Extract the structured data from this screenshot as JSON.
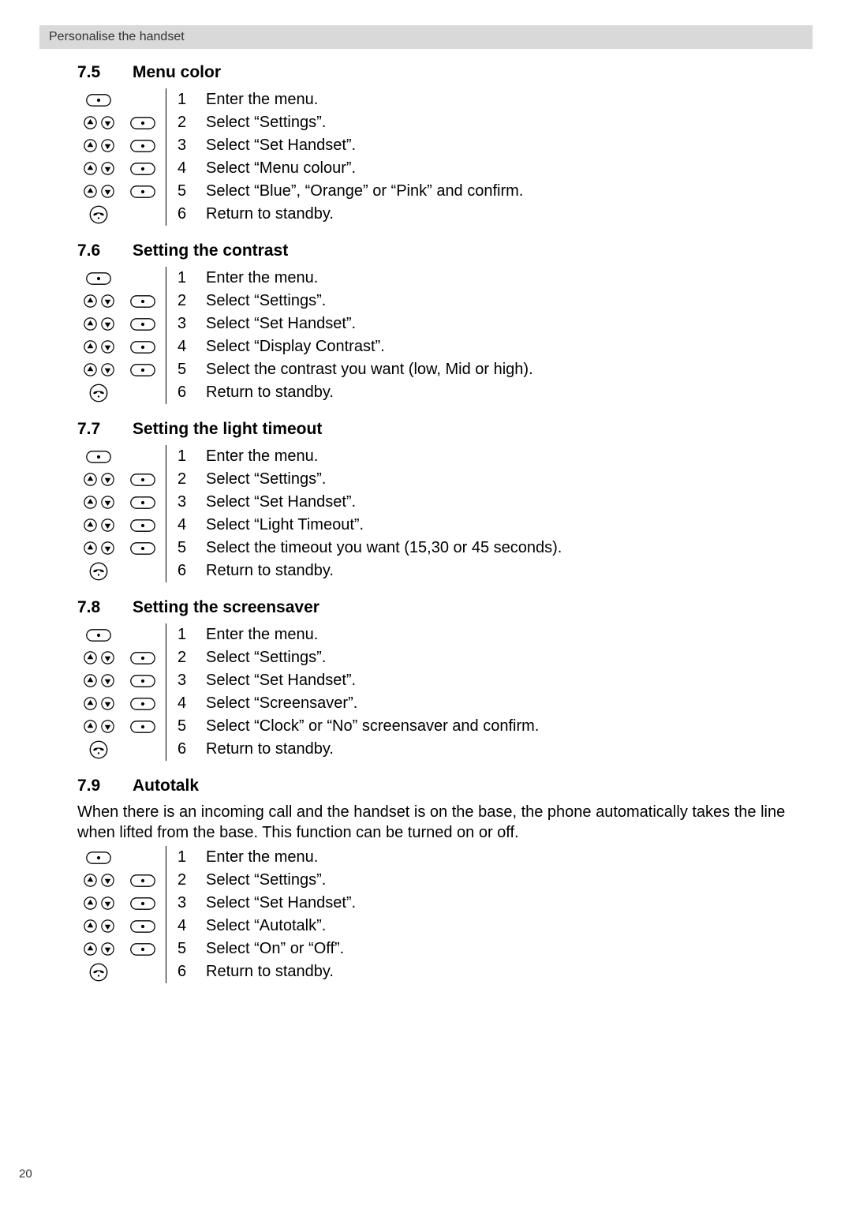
{
  "header": {
    "title": "Personalise the handset"
  },
  "page_number": "20",
  "icons": {
    "menu": {
      "name": "menu-icon"
    },
    "up": {
      "name": "up-icon"
    },
    "down": {
      "name": "down-icon"
    },
    "hangup": {
      "name": "hangup-icon"
    }
  },
  "sections": [
    {
      "number": "7.5",
      "title": "Menu color",
      "intro": "",
      "steps": [
        {
          "icons": [
            "menu"
          ],
          "num": "1",
          "text": "Enter the menu."
        },
        {
          "icons": [
            "updown",
            "menu"
          ],
          "num": "2",
          "text": "Select “Settings”."
        },
        {
          "icons": [
            "updown",
            "menu"
          ],
          "num": "3",
          "text": "Select “Set Handset”."
        },
        {
          "icons": [
            "updown",
            "menu"
          ],
          "num": "4",
          "text": "Select “Menu colour”."
        },
        {
          "icons": [
            "updown",
            "menu"
          ],
          "num": "5",
          "text": "Select “Blue”, “Orange” or “Pink” and confirm."
        },
        {
          "icons": [
            "hangup"
          ],
          "num": "6",
          "text": "Return to standby."
        }
      ]
    },
    {
      "number": "7.6",
      "title": "Setting the contrast",
      "intro": "",
      "steps": [
        {
          "icons": [
            "menu"
          ],
          "num": "1",
          "text": "Enter the menu."
        },
        {
          "icons": [
            "updown",
            "menu"
          ],
          "num": "2",
          "text": "Select “Settings”."
        },
        {
          "icons": [
            "updown",
            "menu"
          ],
          "num": "3",
          "text": "Select “Set Handset”."
        },
        {
          "icons": [
            "updown",
            "menu"
          ],
          "num": "4",
          "text": "Select “Display Contrast”."
        },
        {
          "icons": [
            "updown",
            "menu"
          ],
          "num": "5",
          "text": "Select the contrast you want (low, Mid or high)."
        },
        {
          "icons": [
            "hangup"
          ],
          "num": "6",
          "text": "Return to standby."
        }
      ]
    },
    {
      "number": "7.7",
      "title": "Setting the light timeout",
      "intro": "",
      "steps": [
        {
          "icons": [
            "menu"
          ],
          "num": "1",
          "text": "Enter the menu."
        },
        {
          "icons": [
            "updown",
            "menu"
          ],
          "num": "2",
          "text": "Select “Settings”."
        },
        {
          "icons": [
            "updown",
            "menu"
          ],
          "num": "3",
          "text": "Select “Set Handset”."
        },
        {
          "icons": [
            "updown",
            "menu"
          ],
          "num": "4",
          "text": "Select “Light Timeout”."
        },
        {
          "icons": [
            "updown",
            "menu"
          ],
          "num": "5",
          "text": "Select the timeout you want (15,30 or 45 seconds)."
        },
        {
          "icons": [
            "hangup"
          ],
          "num": "6",
          "text": "Return to standby."
        }
      ]
    },
    {
      "number": "7.8",
      "title": "Setting the screensaver",
      "intro": "",
      "steps": [
        {
          "icons": [
            "menu"
          ],
          "num": "1",
          "text": "Enter the menu."
        },
        {
          "icons": [
            "updown",
            "menu"
          ],
          "num": "2",
          "text": "Select “Settings”."
        },
        {
          "icons": [
            "updown",
            "menu"
          ],
          "num": "3",
          "text": "Select “Set Handset”."
        },
        {
          "icons": [
            "updown",
            "menu"
          ],
          "num": "4",
          "text": "Select “Screensaver”."
        },
        {
          "icons": [
            "updown",
            "menu"
          ],
          "num": "5",
          "text": "Select “Clock” or “No” screensaver and confirm."
        },
        {
          "icons": [
            "hangup"
          ],
          "num": "6",
          "text": "Return to standby."
        }
      ]
    },
    {
      "number": "7.9",
      "title": "Autotalk",
      "intro": "When there is an incoming call and the handset is on the base, the phone automatically takes the line when lifted from the base. This function can be turned on or off.",
      "steps": [
        {
          "icons": [
            "menu"
          ],
          "num": "1",
          "text": "Enter the menu."
        },
        {
          "icons": [
            "updown",
            "menu"
          ],
          "num": "2",
          "text": "Select “Settings”."
        },
        {
          "icons": [
            "updown",
            "menu"
          ],
          "num": "3",
          "text": "Select “Set Handset”."
        },
        {
          "icons": [
            "updown",
            "menu"
          ],
          "num": "4",
          "text": "Select “Autotalk”."
        },
        {
          "icons": [
            "updown",
            "menu"
          ],
          "num": "5",
          "text": "Select “On” or “Off”."
        },
        {
          "icons": [
            "hangup"
          ],
          "num": "6",
          "text": "Return to standby."
        }
      ]
    }
  ]
}
